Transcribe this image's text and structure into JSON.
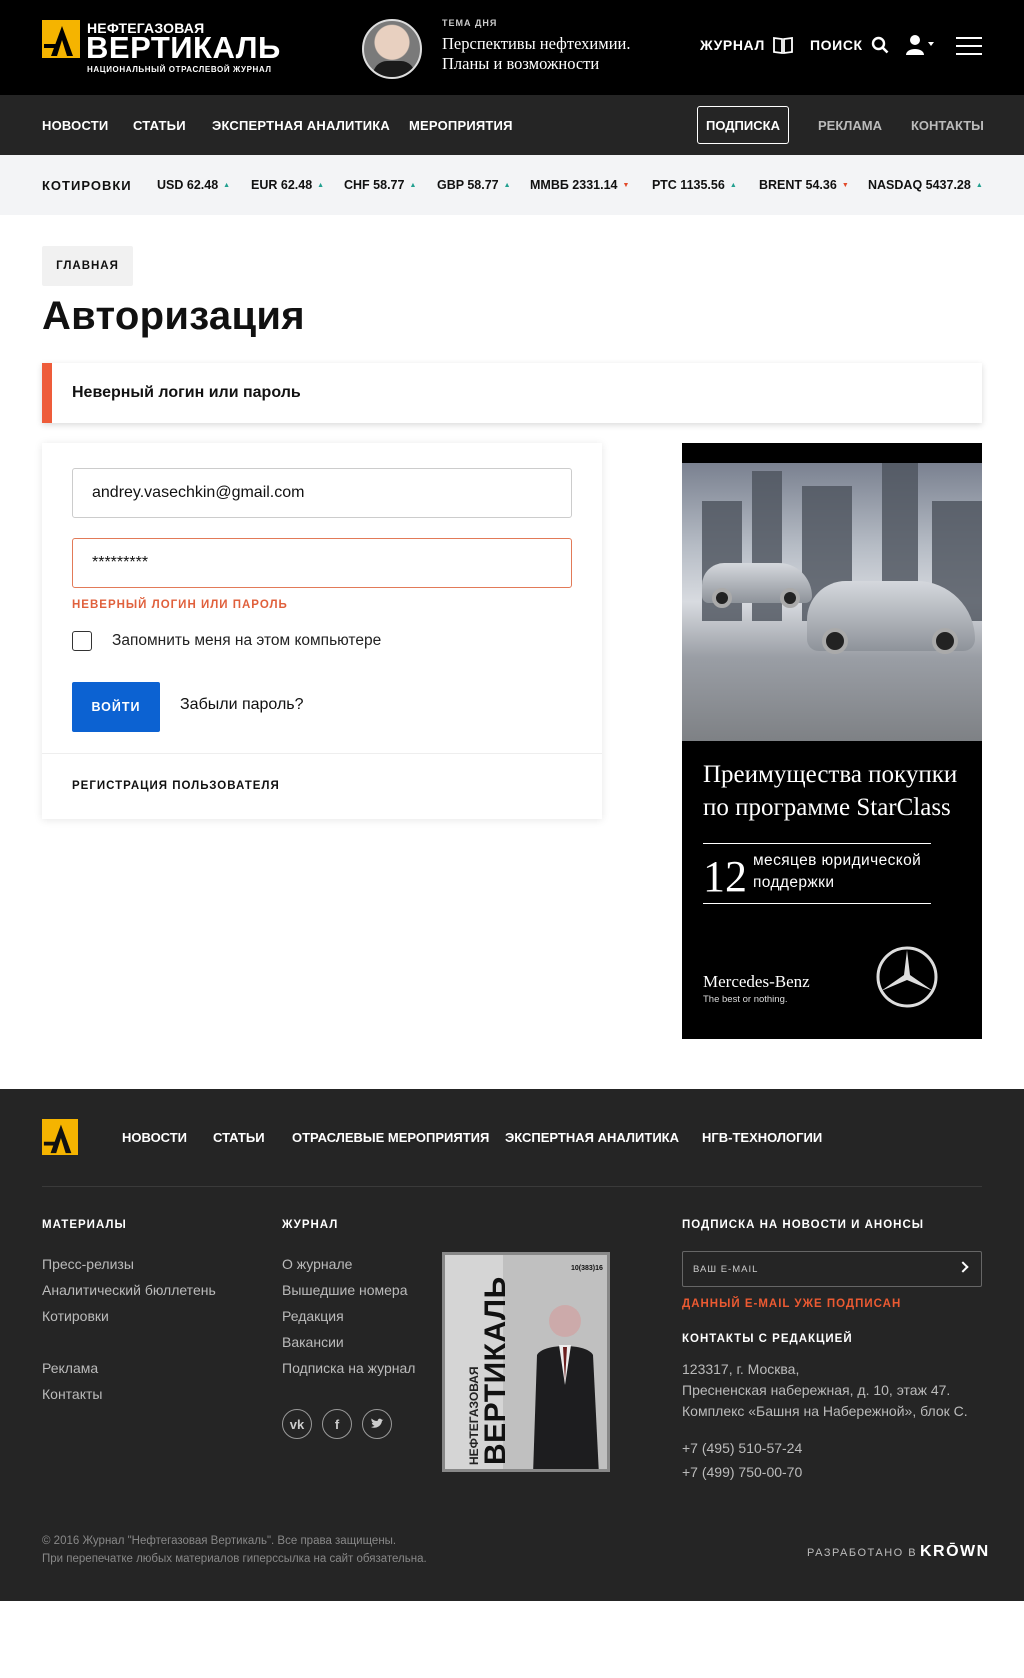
{
  "header": {
    "logo_top": "НЕФТЕГАЗОВАЯ",
    "logo_main": "ВЕРТИКАЛЬ",
    "logo_sub": "НАЦИОНАЛЬНЫЙ ОТРАСЛЕВОЙ ЖУРНАЛ",
    "topic_label": "ТЕМА ДНЯ",
    "topic_line1": "Перспективы нефтехимии.",
    "topic_line2": "Планы и возможности",
    "journal_label": "ЖУРНАЛ",
    "search_label": "ПОИСК"
  },
  "nav": {
    "items": [
      "НОВОСТИ",
      "СТАТЬИ",
      "ЭКСПЕРТНАЯ АНАЛИТИКА",
      "МЕРОПРИЯТИЯ"
    ],
    "subscribe": "ПОДПИСКА",
    "ads": "РЕКЛАМА",
    "contacts": "КОНТАКТЫ"
  },
  "quotes": {
    "title": "КОТИРОВКИ",
    "items": [
      {
        "label": "USD 62.48",
        "dir": "up"
      },
      {
        "label": "EUR 62.48",
        "dir": "up"
      },
      {
        "label": "CHF 58.77",
        "dir": "up"
      },
      {
        "label": "GBP 58.77",
        "dir": "up"
      },
      {
        "label": "ММВБ 2331.14",
        "dir": "down"
      },
      {
        "label": "РТС 1135.56",
        "dir": "up"
      },
      {
        "label": "BRENT 54.36",
        "dir": "down"
      },
      {
        "label": "NASDAQ 5437.28",
        "dir": "up"
      }
    ]
  },
  "page": {
    "breadcrumb": "ГЛАВНАЯ",
    "title": "Авторизация",
    "alert": "Неверный логин или пароль"
  },
  "login": {
    "email_value": "andrey.vasechkin@gmail.com",
    "password_value": "*********",
    "error": "НЕВЕРНЫЙ ЛОГИН ИЛИ ПАРОЛЬ",
    "remember": "Запомнить меня на этом компьютере",
    "remember_checked": false,
    "submit": "ВОЙТИ",
    "forgot": "Забыли пароль?",
    "register": "РЕГИСТРАЦИЯ ПОЛЬЗОВАТЕЛЯ"
  },
  "ad": {
    "headline_line1": "Преимущества покупки",
    "headline_line2": "по программе StarClass",
    "number": "12",
    "number_text_line1": "месяцев юридической",
    "number_text_line2": "поддержки",
    "brand": "Mercedes-Benz",
    "tagline": "The best or nothing."
  },
  "footer": {
    "nav": [
      "НОВОСТИ",
      "СТАТЬИ",
      "ОТРАСЛЕВЫЕ МЕРОПРИЯТИЯ",
      "ЭКСПЕРТНАЯ АНАЛИТИКА",
      "НГВ-ТЕХНОЛОГИИ"
    ],
    "materials_title": "МАТЕРИАЛЫ",
    "materials": [
      "Пресс-релизы",
      "Аналитический бюллетень",
      "Котировки",
      "Реклама",
      "Контакты"
    ],
    "journal_title": "ЖУРНАЛ",
    "journal": [
      "О журнале",
      "Вышедшие номера",
      "Редакция",
      "Вакансии",
      "Подписка на журнал"
    ],
    "social": [
      "vk-icon",
      "facebook-icon",
      "twitter-icon"
    ],
    "magazine": {
      "pre": "НЕФТЕГАЗОВАЯ",
      "title": "ВЕРТИКАЛЬ",
      "issue": "10(383)16"
    },
    "subscribe_title": "ПОДПИСКА НА НОВОСТИ И АНОНСЫ",
    "email_placeholder": "ВАШ E-MAIL",
    "subscribe_error": "ДАННЫЙ E-MAIL УЖЕ ПОДПИСАН",
    "contacts_title": "КОНТАКТЫ С РЕДАКЦИЕЙ",
    "address": [
      "123317, г. Москва,",
      "Пресненская набережная, д. 10, этаж 47.",
      "Комплекс «Башня на Набережной», блок С."
    ],
    "phones": [
      "+7 (495) 510-57-24",
      "+7 (499) 750-00-70"
    ],
    "copyright": "© 2016 Журнал \"Нефтегазовая Вертикаль\". Все права защищены.",
    "reprint": "При перепечатке любых материалов гиперссылка на сайт обязательна.",
    "developed_by": "РАЗРАБОТАНО В",
    "developer": "KRŌWN"
  },
  "colors": {
    "accent_orange": "#ee5c3a",
    "button_blue": "#0c62d2",
    "logo_yellow": "#f5b400",
    "quote_up": "#22a090",
    "quote_down": "#e24a2a"
  }
}
